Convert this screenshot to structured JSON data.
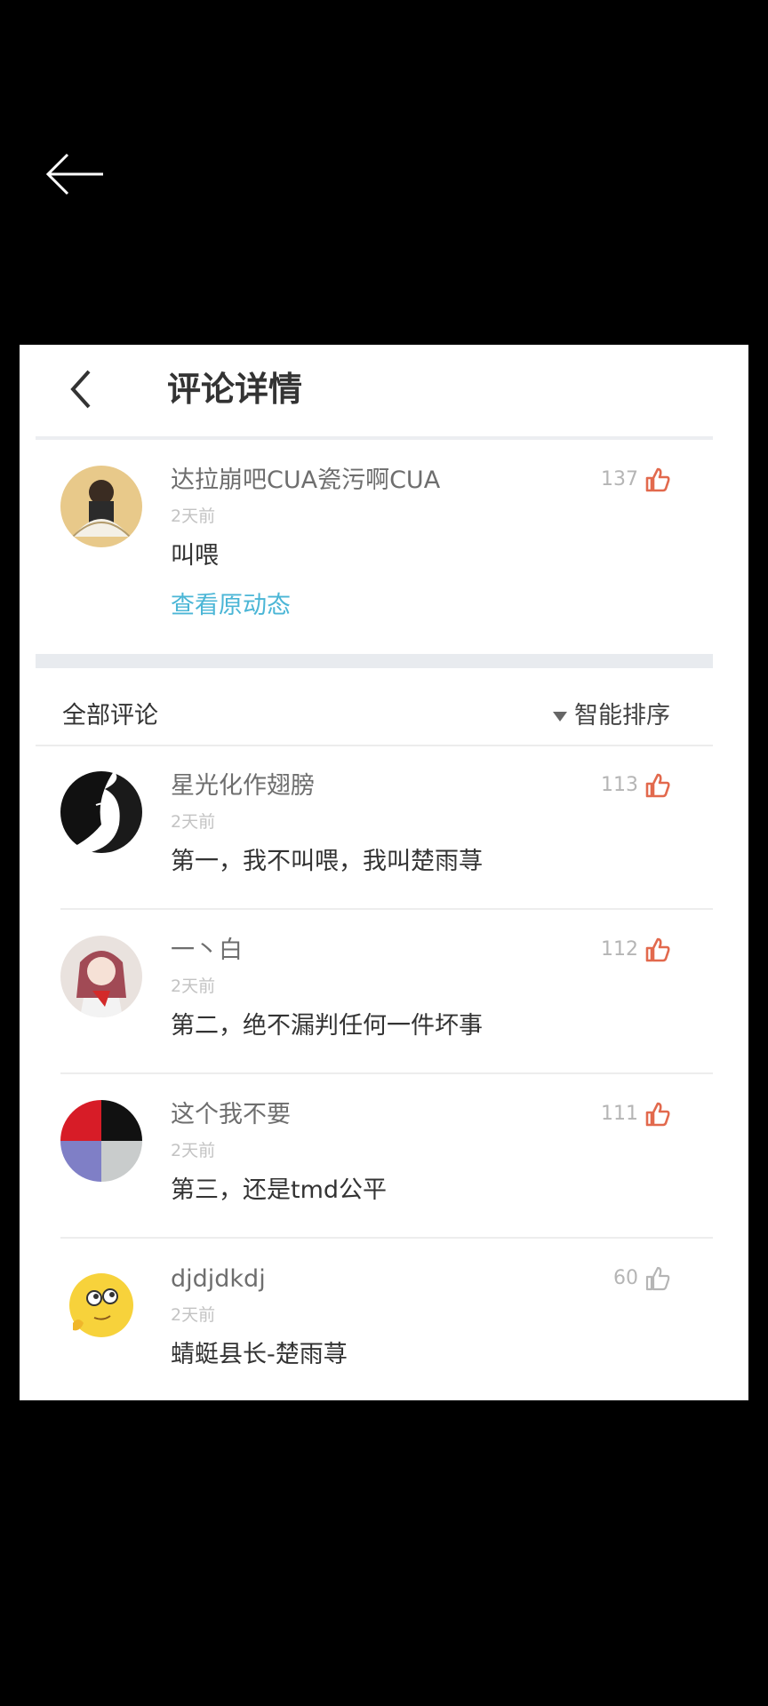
{
  "header": {
    "title": "评论详情"
  },
  "main_comment": {
    "name": "达拉崩吧CUA瓷污啊CUA",
    "time": "2天前",
    "text": "叫喂",
    "likes": "137",
    "view_original": "查看原动态"
  },
  "comments_section": {
    "all_label": "全部评论",
    "sort_label": "智能排序"
  },
  "comments": [
    {
      "name": "星光化作翅膀",
      "time": "2天前",
      "text": "第一，我不叫喂，我叫楚雨荨",
      "likes": "113"
    },
    {
      "name": "一丶白",
      "time": "2天前",
      "text": "第二，绝不漏判任何一件坏事",
      "likes": "112"
    },
    {
      "name": "这个我不要",
      "time": "2天前",
      "text": "第三，还是tmd公平",
      "likes": "111"
    },
    {
      "name": "djdjdkdj",
      "time": "2天前",
      "text": "蜻蜓县长-楚雨荨",
      "likes": "60"
    }
  ],
  "colors": {
    "link": "#4bb6d6",
    "like_active": "#e2694d",
    "like_inactive": "#b5b5b5"
  }
}
